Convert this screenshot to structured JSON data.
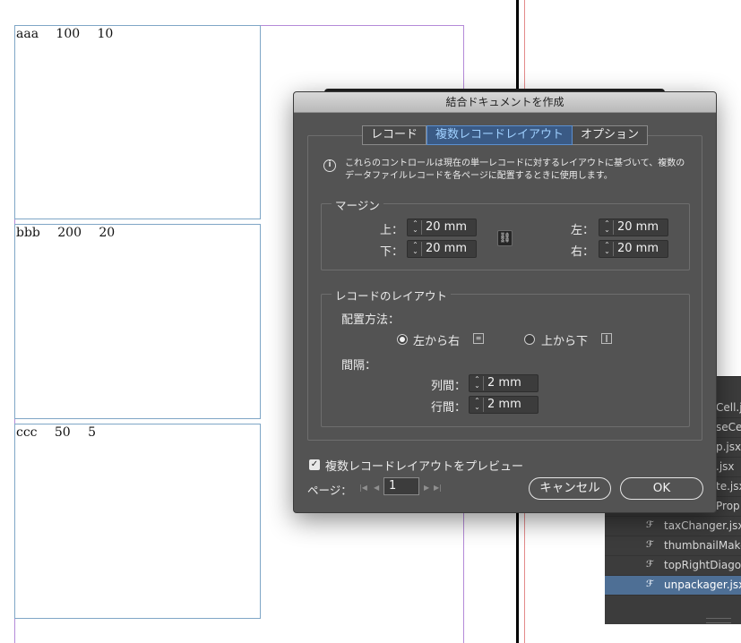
{
  "document": {
    "rows": [
      {
        "name": "aaa",
        "v1": "100",
        "v2": "10"
      },
      {
        "name": "bbb",
        "v1": "200",
        "v2": "20"
      },
      {
        "name": "ccc",
        "v1": "50",
        "v2": "5"
      }
    ]
  },
  "scripts_panel": {
    "items": [
      {
        "label": "Cell.j",
        "partial": true
      },
      {
        "label": "seCe",
        "partial": true
      },
      {
        "label": "p.jsx",
        "partial": true
      },
      {
        "label": ".jsx",
        "partial": true
      },
      {
        "label": "te.jsx",
        "partial": true
      },
      {
        "label": "Prop",
        "partial": true
      },
      {
        "label": "taxChanger.jsx",
        "partial": false
      },
      {
        "label": "thumbnailMake",
        "partial": false
      },
      {
        "label": "topRightDiago",
        "partial": false
      },
      {
        "label": "unpackager.jsx",
        "partial": false,
        "selected": true
      }
    ],
    "item_icon": "script-icon"
  },
  "dialog": {
    "title": "結合ドキュメントを作成",
    "tabs": [
      {
        "label": "レコード",
        "active": false
      },
      {
        "label": "複数レコードレイアウト",
        "active": true
      },
      {
        "label": "オプション",
        "active": false
      }
    ],
    "info_line1": "これらのコントロールは現在の単一レコードに対するレイアウトに基づいて、複数の",
    "info_line2": "データファイルレコードを各ページに配置するときに使用します。",
    "margins": {
      "title": "マージン",
      "top_label": "上：",
      "top_value": "20 mm",
      "bottom_label": "下：",
      "bottom_value": "20 mm",
      "left_label": "左：",
      "left_value": "20 mm",
      "right_label": "右：",
      "right_value": "20 mm",
      "link_icon": "chain-link-icon"
    },
    "layout": {
      "title": "レコードのレイアウト",
      "arrangement_label": "配置方法：",
      "option_lr": "左から右",
      "option_tb": "上から下",
      "selected": "左から右",
      "spacing_label": "間隔：",
      "column_label": "列間：",
      "column_value": "2 mm",
      "row_label": "行間：",
      "row_value": "2 mm"
    },
    "preview_label": "複数レコードレイアウトをプレビュー",
    "preview_checked": true,
    "page_label": "ページ：",
    "page_value": "1",
    "cancel_label": "キャンセル",
    "ok_label": "OK"
  }
}
